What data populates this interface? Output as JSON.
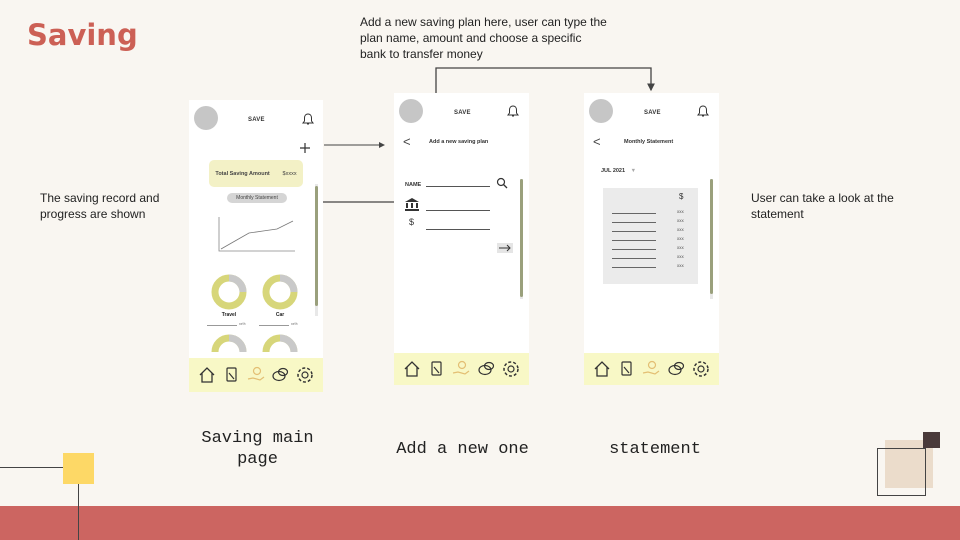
{
  "page": {
    "title": "Saving",
    "notes": {
      "left": "The saving record and progress are shown",
      "top": "Add a new saving plan here, user can type the plan name, amount and choose a specific bank to transfer money",
      "right": "User can take a look at the statement"
    },
    "captions": {
      "main": "Saving main page",
      "add": "Add a new one",
      "statement": "statement"
    }
  },
  "main_screen": {
    "header": "SAVE",
    "total_label": "Total Saving Amount",
    "total_value": "$xxxx",
    "statement_button": "Monthly Statement",
    "categories": [
      "Travel",
      "Car"
    ],
    "percent_label": "xx%"
  },
  "add_screen": {
    "header": "SAVE",
    "subtitle": "Add a new saving plan",
    "name_label": "NAME",
    "dollar_label": "$"
  },
  "statement_screen": {
    "header": "SAVE",
    "subtitle": "Monthly Statement",
    "month": "JUL 2021",
    "dollar_label": "$",
    "rows": [
      "xxx",
      "xxx",
      "xxx",
      "xxx",
      "xxx",
      "xxx",
      "xxx"
    ]
  },
  "nav_icons": [
    "home-icon",
    "card-icon",
    "money-hand-icon",
    "chat-icon",
    "settings-icon"
  ],
  "colors": {
    "accent": "#cc6055",
    "nav_bg": "#f8f8c6",
    "donut": "#d7d67a",
    "card": "#f3f1c6"
  }
}
